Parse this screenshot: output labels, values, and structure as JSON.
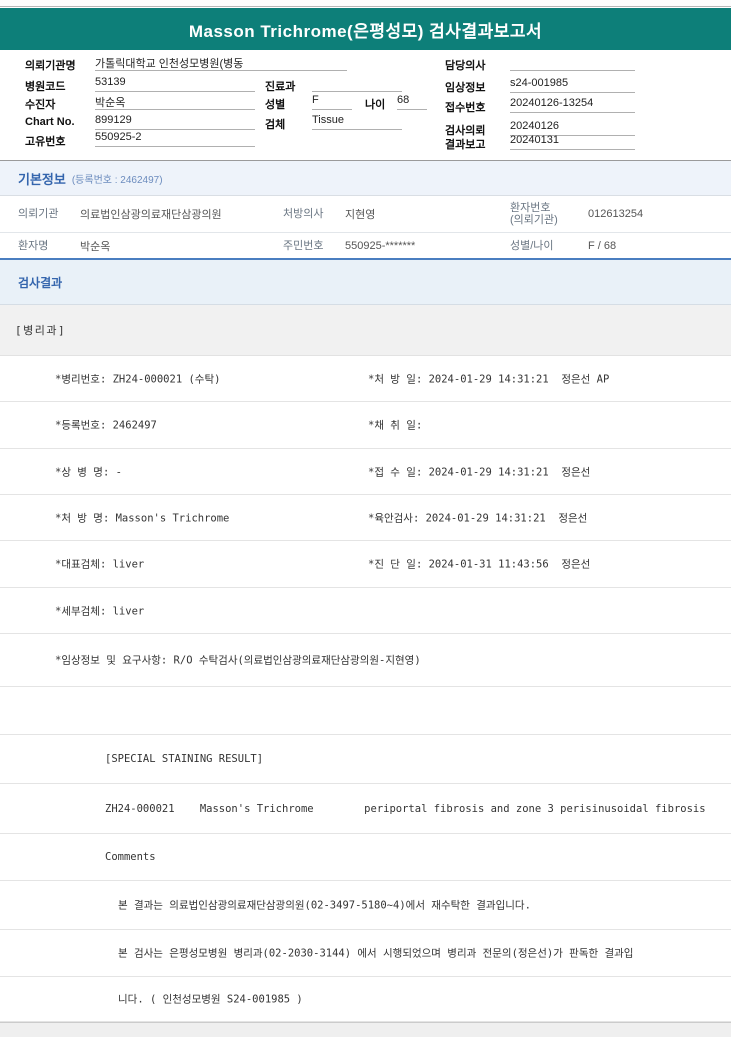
{
  "title": "Masson Trichrome(은평성모) 검사결과보고서",
  "patient_header": {
    "left": [
      {
        "label": "의뢰기관명",
        "value": "가톨릭대학교 인천성모병원(병동"
      },
      {
        "label": "병원코드",
        "value": "53139"
      },
      {
        "label": "수진자",
        "value": "박순옥"
      },
      {
        "label": "Chart No.",
        "value": "899129"
      },
      {
        "label": "고유번호",
        "value": "550925-2"
      }
    ],
    "mid": {
      "dept": {
        "label": "진료과",
        "value": ""
      },
      "sex": {
        "label": "성별",
        "value": "F"
      },
      "age": {
        "label": "나이",
        "value": "68"
      },
      "specimen": {
        "label": "검체",
        "value": "Tissue"
      }
    },
    "right": [
      {
        "label": "담당의사",
        "value": ""
      },
      {
        "label": "임상정보",
        "value": "s24-001985"
      },
      {
        "label": "접수번호",
        "value": "20240126-13254"
      },
      {
        "label": "검사의뢰",
        "value": "20240126"
      },
      {
        "label": "결과보고",
        "value": "20240131"
      }
    ]
  },
  "basic_info": {
    "section_title": "기본정보",
    "reg_no_label": "(등록번호 : 2462497)",
    "rows": [
      {
        "c1l": "의뢰기관",
        "c1v": "의료법인삼광의료재단삼광의원",
        "c2l": "처방의사",
        "c2v": "지현영",
        "c3l": "환자번호",
        "c3l2": "(의뢰기관)",
        "c3v": "012613254"
      },
      {
        "c1l": "환자명",
        "c1v": "박순옥",
        "c2l": "주민번호",
        "c2v": "550925-*******",
        "c3l": "성별/나이",
        "c3l2": "",
        "c3v": "F / 68"
      }
    ]
  },
  "results_section": {
    "section_title": "검사결과",
    "dept": "[병리과]"
  },
  "results": {
    "rows": [
      {
        "left": "*병리번호: ZH24-000021 (수탁)",
        "right": "*처 방 일: 2024-01-29 14:31:21  정은선 AP"
      },
      {
        "left": "*등록번호: 2462497",
        "right": "*채 취 일:"
      },
      {
        "left": "*상 병 명: -",
        "right": "*접 수 일: 2024-01-29 14:31:21  정은선"
      },
      {
        "left": "*처 방 명: Masson's Trichrome",
        "right": "*육안검사: 2024-01-29 14:31:21  정은선"
      },
      {
        "left": "*대표검체: liver",
        "right": "*진 단 일: 2024-01-31 11:43:56  정은선"
      },
      {
        "left": "*세부검체: liver",
        "right": ""
      },
      {
        "left": "*임상정보 및 요구사항: R/O 수탁검사(의료법인삼광의료재단삼광의원-지현영)",
        "right": ""
      },
      {
        "left": "",
        "right": ""
      },
      {
        "text": "[SPECIAL STAINING RESULT]"
      },
      {
        "text": "ZH24-000021    Masson's Trichrome        periportal fibrosis and zone 3 perisinusoidal fibrosis"
      },
      {
        "text": "Comments"
      },
      {
        "text": "본 결과는 의료법인삼광의료재단삼광의원(02-3497-5180~4)에서 재수탁한 결과입니다."
      },
      {
        "text": "본 검사는 은평성모병원 병리과(02-2030-3144) 에서 시행되었으며 병리과 전문의(정은선)가 판독한 결과입"
      },
      {
        "text": "니다. ( 인천성모병원 S24-001985 )"
      }
    ]
  },
  "colors": {
    "header_teal": "#0d7f79",
    "section_blue": "#3465ad",
    "table_bottom_rule_blue": "#4a7ec0",
    "section_band_bg": "#e9f1f8"
  }
}
